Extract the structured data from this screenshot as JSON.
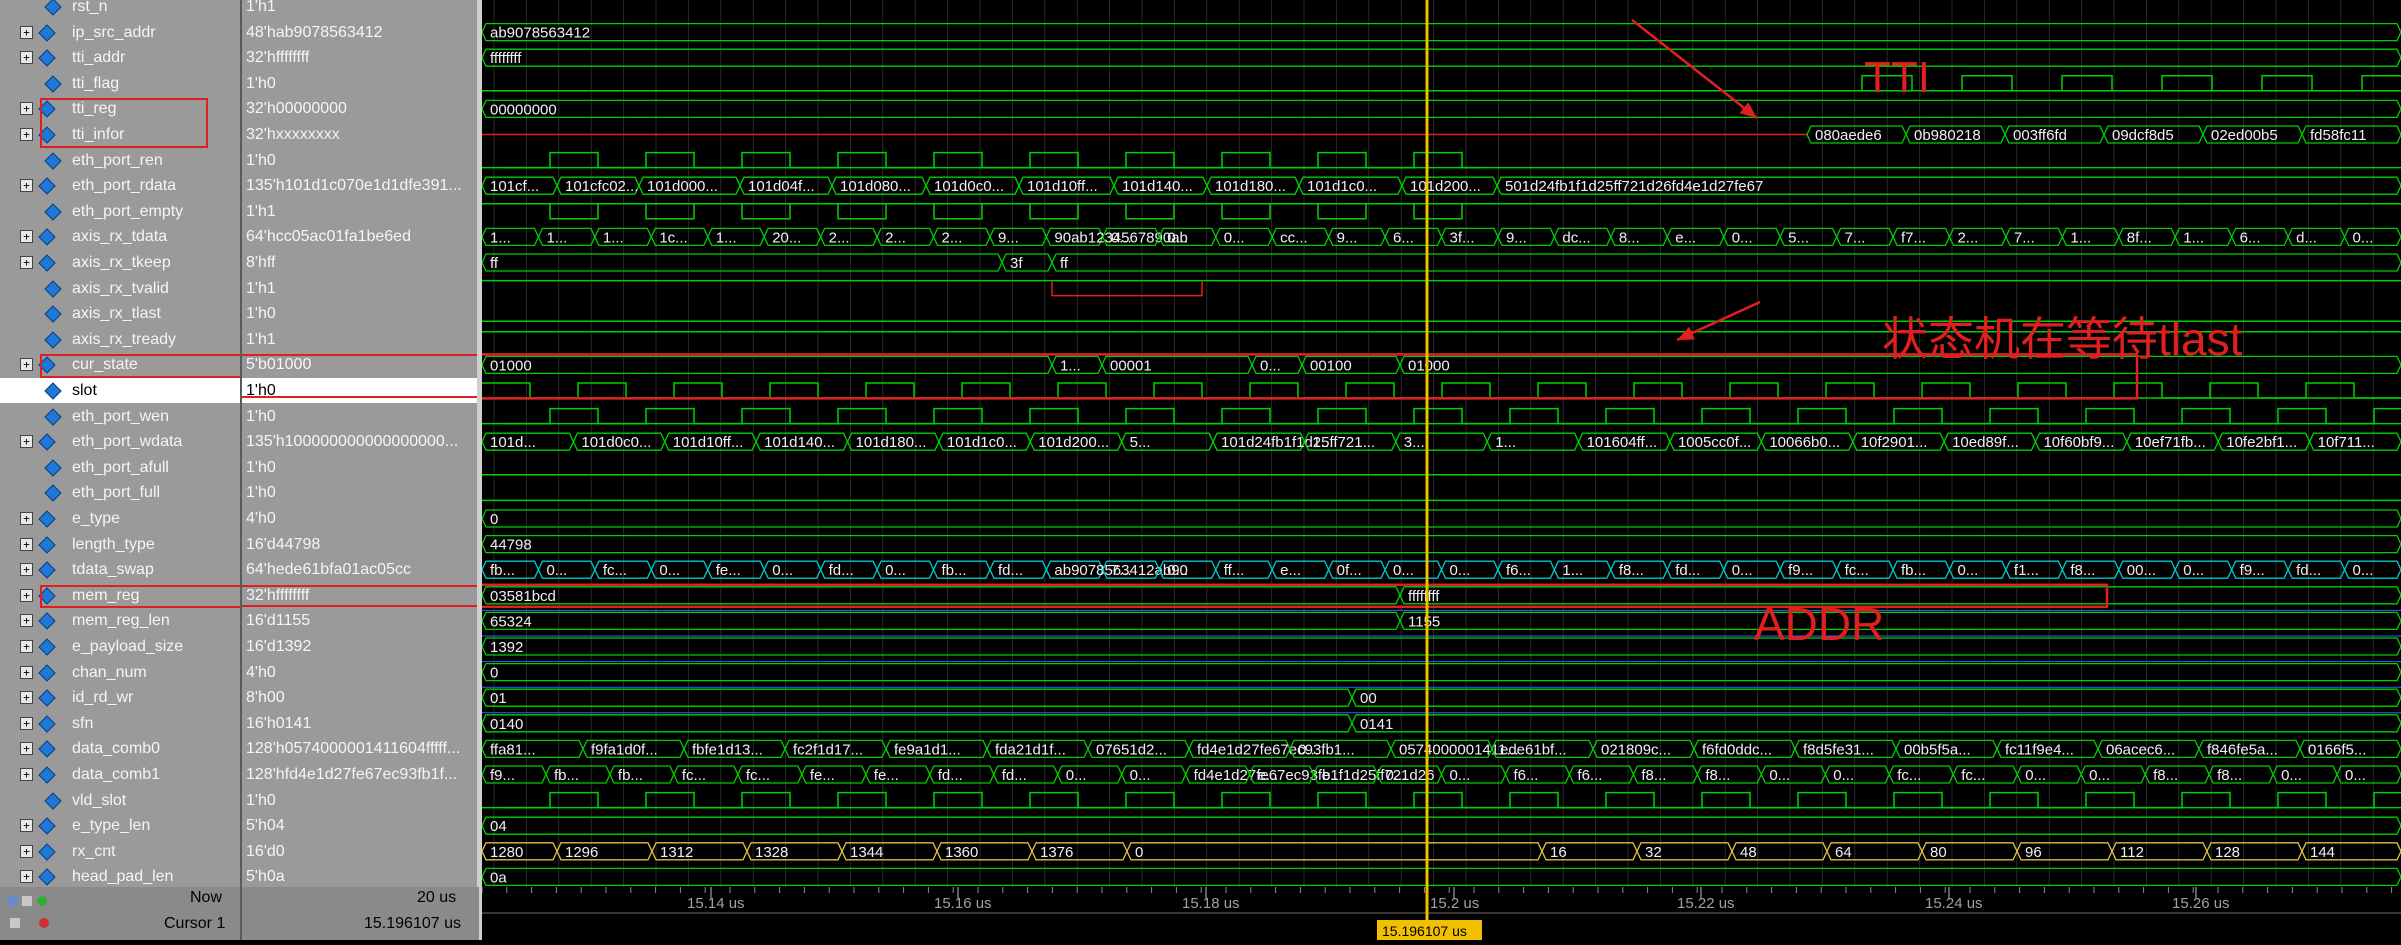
{
  "signals": [
    {
      "name": "rst_n",
      "value": "1'h1",
      "expand": false
    },
    {
      "name": "ip_src_addr",
      "value": "48'hab9078563412",
      "expand": true
    },
    {
      "name": "tti_addr",
      "value": "32'hffffffff",
      "expand": true
    },
    {
      "name": "tti_flag",
      "value": "1'h0",
      "expand": false
    },
    {
      "name": "tti_reg",
      "value": "32'h00000000",
      "expand": true
    },
    {
      "name": "tti_infor",
      "value": "32'hxxxxxxxx",
      "expand": true
    },
    {
      "name": "eth_port_ren",
      "value": "1'h0",
      "expand": false
    },
    {
      "name": "eth_port_rdata",
      "value": "135'h101d1c070e1d1dfe391...",
      "expand": true
    },
    {
      "name": "eth_port_empty",
      "value": "1'h1",
      "expand": false
    },
    {
      "name": "axis_rx_tdata",
      "value": "64'hcc05ac01fa1be6ed",
      "expand": true
    },
    {
      "name": "axis_rx_tkeep",
      "value": "8'hff",
      "expand": true
    },
    {
      "name": "axis_rx_tvalid",
      "value": "1'h1",
      "expand": false
    },
    {
      "name": "axis_rx_tlast",
      "value": "1'h0",
      "expand": false
    },
    {
      "name": "axis_rx_tready",
      "value": "1'h1",
      "expand": false
    },
    {
      "name": "cur_state",
      "value": "5'b01000",
      "expand": true
    },
    {
      "name": "slot",
      "value": "1'h0",
      "expand": false
    },
    {
      "name": "eth_port_wen",
      "value": "1'h0",
      "expand": false
    },
    {
      "name": "eth_port_wdata",
      "value": "135'h100000000000000000...",
      "expand": true
    },
    {
      "name": "eth_port_afull",
      "value": "1'h0",
      "expand": false
    },
    {
      "name": "eth_port_full",
      "value": "1'h0",
      "expand": false
    },
    {
      "name": "e_type",
      "value": "4'h0",
      "expand": true
    },
    {
      "name": "length_type",
      "value": "16'd44798",
      "expand": true
    },
    {
      "name": "tdata_swap",
      "value": "64'hede61bfa01ac05cc",
      "expand": true
    },
    {
      "name": "mem_reg",
      "value": "32'hffffffff",
      "expand": true
    },
    {
      "name": "mem_reg_len",
      "value": "16'd1155",
      "expand": true
    },
    {
      "name": "e_payload_size",
      "value": "16'd1392",
      "expand": true
    },
    {
      "name": "chan_num",
      "value": "4'h0",
      "expand": true
    },
    {
      "name": "id_rd_wr",
      "value": "8'h00",
      "expand": true
    },
    {
      "name": "sfn",
      "value": "16'h0141",
      "expand": true
    },
    {
      "name": "data_comb0",
      "value": "128'h0574000001411604fffff...",
      "expand": true
    },
    {
      "name": "data_comb1",
      "value": "128'hfd4e1d27fe67ec93fb1f...",
      "expand": true
    },
    {
      "name": "vld_slot",
      "value": "1'h0",
      "expand": false
    },
    {
      "name": "e_type_len",
      "value": "5'h04",
      "expand": true
    },
    {
      "name": "rx_cnt",
      "value": "16'd0",
      "expand": true
    },
    {
      "name": "head_pad_len",
      "value": "5'h0a",
      "expand": true
    }
  ],
  "bus_text": {
    "ip_src_addr": [
      "ab9078563412"
    ],
    "tti_addr": [
      "ffffffff"
    ],
    "tti_reg": [
      "00000000"
    ],
    "tti_infor": [
      "080aede6",
      "0b980218",
      "003ff6fd",
      "09dcf8d5",
      "02ed00b5",
      "fd58fc11"
    ],
    "eth_port_rdata": [
      "101cf...",
      "101cfc02...",
      "101d000...",
      "101d04f...",
      "101d080...",
      "101d0c0...",
      "101d10ff...",
      "101d140...",
      "101d180...",
      "101d1c0...",
      "101d200...",
      "501d24fb1f1d25ff721d26fd4e1d27fe67"
    ],
    "axis_rx_tdata": [
      "1...",
      "1...",
      "1...",
      "1c...",
      "1...",
      "20...",
      "2...",
      "2...",
      "2...",
      "9...",
      "90ab1234567890ab",
      "0...",
      "0...",
      "0...",
      "cc...",
      "9...",
      "6...",
      "3f...",
      "9...",
      "dc...",
      "8...",
      "e...",
      "0...",
      "5...",
      "7...",
      "f7...",
      "2...",
      "7...",
      "1...",
      "8f...",
      "1...",
      "6...",
      "d...",
      "0..."
    ],
    "axis_rx_tkeep": [
      "ff",
      "3f",
      "ff"
    ],
    "cur_state": [
      "01000",
      "1...",
      "00001",
      "0...",
      "00100",
      "01000"
    ],
    "eth_port_wdata": [
      "101d...",
      "101d0c0...",
      "101d10ff...",
      "101d140...",
      "101d180...",
      "101d1c0...",
      "101d200...",
      "5...",
      "101d24fb1f1d25ff721...",
      "1...",
      "3...",
      "1...",
      "101604ff...",
      "1005cc0f...",
      "10066b0...",
      "10f2901...",
      "10ed89f...",
      "10f60bf9...",
      "10ef71fb...",
      "10fe2bf1...",
      "10f711..."
    ],
    "e_type": [
      "0"
    ],
    "length_type": [
      "44798"
    ],
    "tdata_swap": [
      "fb...",
      "0...",
      "fc...",
      "0...",
      "fe...",
      "0...",
      "fd...",
      "0...",
      "fb...",
      "fd...",
      "ab9078563412ab90",
      "7...",
      "0...",
      "ff...",
      "e...",
      "0f...",
      "0...",
      "0...",
      "f6...",
      "1...",
      "f8...",
      "fd...",
      "0...",
      "f9...",
      "fc...",
      "fb...",
      "0...",
      "f1...",
      "f8...",
      "00...",
      "0...",
      "f9...",
      "fd...",
      "0..."
    ],
    "mem_reg": [
      "03581bcd",
      "ffffffff"
    ],
    "mem_reg_len": [
      "65324",
      "1155"
    ],
    "e_payload_size": [
      "1392"
    ],
    "chan_num": [
      "0"
    ],
    "id_rd_wr": [
      "01",
      "00"
    ],
    "sfn": [
      "0140",
      "0141"
    ],
    "data_comb0": [
      "ffa81...",
      "f9fa1d0f...",
      "fbfe1d13...",
      "fc2f1d17...",
      "fe9a1d1...",
      "fda21d1f...",
      "07651d2...",
      "fd4e1d27fe67ec93fb1...",
      "0...",
      "0574000001411...",
      "ede61bf...",
      "021809c...",
      "f6fd0ddc...",
      "f8d5fe31...",
      "00b5f5a...",
      "fc11f9e4...",
      "06acec6...",
      "f846fe5a...",
      "0166f5..."
    ],
    "data_comb1": [
      "f9...",
      "fb...",
      "fb...",
      "fc...",
      "fc...",
      "fe...",
      "fe...",
      "fd...",
      "fd...",
      "0...",
      "0...",
      "fd4e1d27fe67ec93fb1f1d25ff721d26",
      "e...",
      "e...",
      "0...",
      "0...",
      "f6...",
      "f6...",
      "f8...",
      "f8...",
      "0...",
      "0...",
      "fc...",
      "fc...",
      "0...",
      "0...",
      "f8...",
      "f8...",
      "0...",
      "0..."
    ],
    "e_type_len": [
      "04"
    ],
    "rx_cnt": [
      "1280",
      "1296",
      "1312",
      "1328",
      "1344",
      "1360",
      "1376",
      "0",
      "16",
      "32",
      "48",
      "64",
      "80",
      "96",
      "112",
      "128",
      "144"
    ],
    "head_pad_len": [
      "0a"
    ]
  },
  "annotations": {
    "tti": "TTI",
    "state_wait": "状态机在等待tlast",
    "addr": "ADDR"
  },
  "bottom": {
    "now_label": "Now",
    "now_value": "20 us",
    "cursor_label": "Cursor 1",
    "cursor_value": "15.196107 us",
    "cursor_time": "15.196107 us"
  },
  "timeline": {
    "ticks": [
      "15.14 us",
      "15.16 us",
      "15.18 us",
      "15.2 us",
      "15.22 us",
      "15.24 us",
      "15.26 us"
    ]
  },
  "colors": {
    "bus": "#00d000",
    "bit": "#00d000",
    "swap": "#00c8c8",
    "blue": "#3060ff",
    "red": "#e02020",
    "cursor": "#f0c000",
    "annot": "#e02020"
  }
}
